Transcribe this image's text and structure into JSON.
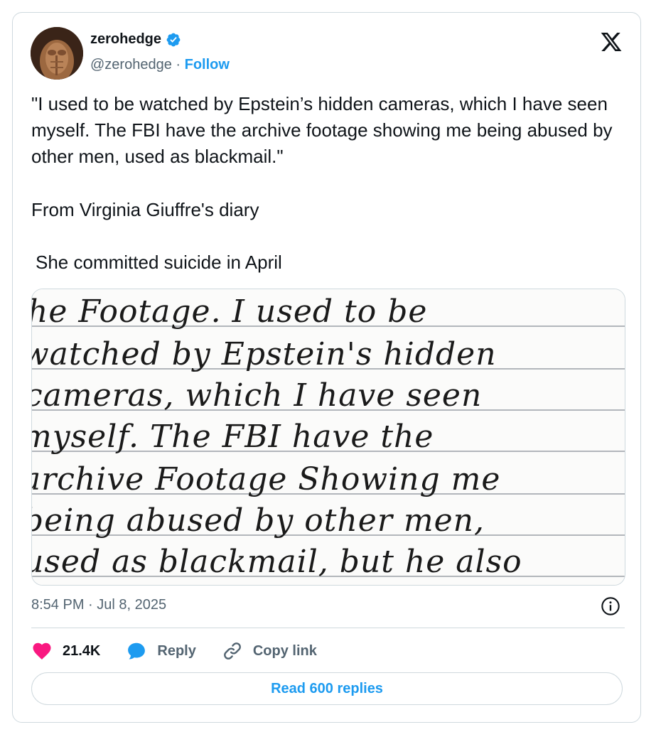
{
  "author": {
    "name": "zerohedge",
    "handle": "@zerohedge",
    "separator": "·",
    "follow_label": "Follow",
    "verified": true
  },
  "tweet": {
    "paragraphs": [
      "\"I used to be watched by Epstein’s hidden cameras, which I have seen myself. The FBI have the archive footage showing me being abused by other men, used as blackmail.\"",
      "From Virginia Giuffre's diary",
      "She committed suicide in April"
    ],
    "timestamp": "8:54 PM · Jul 8, 2025"
  },
  "media": {
    "handwriting_lines": [
      "he Footage. I used to be",
      "watched by Epstein's hidden",
      "cameras, which I have seen",
      "myself. The FBI have the",
      "archive Footage Showing me",
      "being abused by other men,",
      "used as blackmail, but he also"
    ]
  },
  "actions": {
    "likes_count": "21.4K",
    "reply_label": "Reply",
    "copy_link_label": "Copy link"
  },
  "footer": {
    "read_replies_label": "Read 600 replies"
  },
  "colors": {
    "accent": "#1d9bf0",
    "like": "#f91880",
    "muted": "#536471",
    "border": "#cfd9de"
  },
  "icons": [
    "verified-badge-icon",
    "x-logo-icon",
    "info-icon",
    "heart-icon",
    "reply-bubble-icon",
    "link-icon"
  ]
}
